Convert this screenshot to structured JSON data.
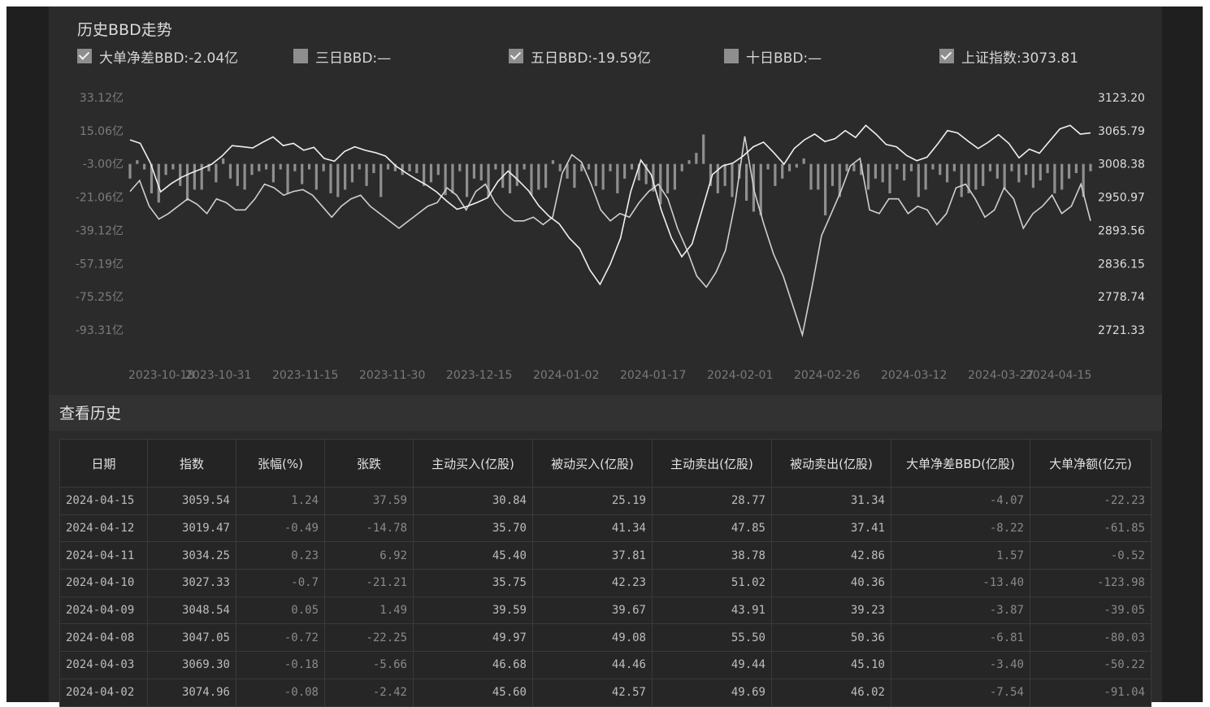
{
  "chart_header": {
    "title": "历史BBD走势",
    "legend": [
      {
        "label": "大单净差BBD:-2.04亿",
        "checked": true
      },
      {
        "label": "三日BBD:—",
        "checked": false
      },
      {
        "label": "五日BBD:-19.59亿",
        "checked": true
      },
      {
        "label": "十日BBD:—",
        "checked": false
      },
      {
        "label": "上证指数:3073.81",
        "checked": true
      }
    ]
  },
  "chart_data": {
    "type": "line",
    "left_axis_ticks": [
      "33.12亿",
      "15.06亿",
      "-3.00亿",
      "-21.06亿",
      "-39.12亿",
      "-57.19亿",
      "-75.25亿",
      "-93.31亿"
    ],
    "left_axis_values": [
      33.12,
      15.06,
      -3.0,
      -21.06,
      -39.12,
      -57.19,
      -75.25,
      -93.31
    ],
    "right_axis_ticks": [
      "3123.20",
      "3065.79",
      "3008.38",
      "2950.97",
      "2893.56",
      "2836.15",
      "2778.74",
      "2721.33"
    ],
    "right_axis_values": [
      3123.2,
      3065.79,
      3008.38,
      2950.97,
      2893.56,
      2836.15,
      2778.74,
      2721.33
    ],
    "x_ticks": [
      "2023-10-18",
      "2023-10-31",
      "2023-11-15",
      "2023-11-30",
      "2023-12-15",
      "2024-01-02",
      "2024-01-17",
      "2024-02-01",
      "2024-02-26",
      "2024-03-12",
      "2024-03-27",
      "2024-04-15"
    ],
    "grid": false,
    "series": [
      {
        "name": "大单净差BBD",
        "kind": "bar",
        "axis": "left",
        "values": [
          -8,
          2,
          -3,
          -16,
          -21,
          -6,
          -3,
          -12,
          -20,
          -14,
          -14,
          -4,
          -10,
          3,
          -8,
          -12,
          -14,
          -6,
          -4,
          -3,
          -10,
          -3,
          -16,
          -4,
          -11,
          -3,
          -14,
          -4,
          -16,
          -18,
          -14,
          -10,
          -3,
          -12,
          -5,
          -18,
          -3,
          -4,
          -6,
          -4,
          -5,
          -12,
          -10,
          -6,
          -17,
          -16,
          -4,
          -18,
          -8,
          -9,
          -18,
          -3,
          -13,
          -16,
          -12,
          -3,
          -17,
          -14,
          -13,
          2,
          -4,
          -8,
          -13,
          -4,
          -3,
          -12,
          -14,
          -4,
          -16,
          -8,
          -3,
          -9,
          -11,
          -15,
          -22,
          -16,
          -14,
          -4,
          2,
          6,
          16,
          -12,
          -16,
          -12,
          -18,
          -8,
          -20,
          -26,
          -28,
          -3,
          -12,
          -8,
          -4,
          -2,
          3,
          -14,
          -14,
          -28,
          -12,
          -18,
          -4,
          -4,
          -6,
          -14,
          -8,
          -10,
          -16,
          -3,
          -9,
          -4,
          -18,
          -14,
          -3,
          -6,
          -10,
          -4,
          -18,
          -16,
          -14,
          -12,
          -4,
          -8,
          -14,
          -4,
          -10,
          -6,
          -13,
          -9,
          -5,
          -16,
          -14,
          -8,
          -5,
          -18,
          -4
        ]
      },
      {
        "name": "五日BBD",
        "kind": "line",
        "axis": "left",
        "values": [
          -18,
          -12,
          -26,
          -33,
          -30,
          -26,
          -22,
          -25,
          -30,
          -22,
          -24,
          -28,
          -28,
          -22,
          -14,
          -16,
          -20,
          -18,
          -17,
          -20,
          -26,
          -32,
          -26,
          -22,
          -20,
          -26,
          -30,
          -34,
          -38,
          -34,
          -30,
          -26,
          -24,
          -16,
          -20,
          -28,
          -18,
          -14,
          -24,
          -30,
          -34,
          -34,
          -32,
          -36,
          -32,
          -8,
          2,
          -2,
          -14,
          -28,
          -34,
          -30,
          -32,
          -24,
          -18,
          -14,
          -22,
          -38,
          -50,
          -64,
          -70,
          -62,
          -50,
          -24,
          12,
          -18,
          -36,
          -52,
          -64,
          -80,
          -96,
          -70,
          -42,
          -30,
          -18,
          -4,
          0,
          -28,
          -30,
          -22,
          -22,
          -30,
          -26,
          -28,
          -36,
          -30,
          -16,
          -14,
          -22,
          -32,
          -28,
          -16,
          -22,
          -38,
          -30,
          -26,
          -20,
          -30,
          -26,
          -14,
          -34
        ]
      },
      {
        "name": "上证指数",
        "kind": "line",
        "axis": "right",
        "values": [
          3050,
          3044,
          3010,
          2960,
          2974,
          2985,
          2993,
          3000,
          3008,
          3022,
          3040,
          3038,
          3036,
          3046,
          3055,
          3040,
          3044,
          3032,
          3037,
          3018,
          3013,
          3030,
          3038,
          3032,
          3028,
          3022,
          3005,
          2993,
          2982,
          2972,
          2960,
          2944,
          2930,
          2935,
          2942,
          2950,
          2978,
          2996,
          2980,
          2962,
          2936,
          2918,
          2905,
          2880,
          2862,
          2825,
          2800,
          2835,
          2880,
          2960,
          3015,
          2990,
          2928,
          2880,
          2848,
          2870,
          2930,
          2990,
          3005,
          3010,
          3022,
          3038,
          3046,
          3028,
          3008,
          3035,
          3050,
          3060,
          3047,
          3052,
          3066,
          3054,
          3075,
          3060,
          3042,
          3038,
          3023,
          3014,
          3020,
          3042,
          3066,
          3062,
          3048,
          3035,
          3046,
          3059,
          3044,
          3019,
          3034,
          3027,
          3048,
          3069,
          3075,
          3060,
          3062
        ]
      }
    ]
  },
  "history": {
    "title": "查看历史",
    "columns": [
      "日期",
      "指数",
      "张幅(%)",
      "张跌",
      "主动买入(亿股)",
      "被动买入(亿股)",
      "主动卖出(亿股)",
      "被动卖出(亿股)",
      "大单净差BBD(亿股)",
      "大单净额(亿元)"
    ],
    "rows": [
      [
        "2024-04-15",
        "3059.54",
        "1.24",
        "37.59",
        "30.84",
        "25.19",
        "28.77",
        "31.34",
        "-4.07",
        "-22.23"
      ],
      [
        "2024-04-12",
        "3019.47",
        "-0.49",
        "-14.78",
        "35.70",
        "41.34",
        "47.85",
        "37.41",
        "-8.22",
        "-61.85"
      ],
      [
        "2024-04-11",
        "3034.25",
        "0.23",
        "6.92",
        "45.40",
        "37.81",
        "38.78",
        "42.86",
        "1.57",
        "-0.52"
      ],
      [
        "2024-04-10",
        "3027.33",
        "-0.7",
        "-21.21",
        "35.75",
        "42.23",
        "51.02",
        "40.36",
        "-13.40",
        "-123.98"
      ],
      [
        "2024-04-09",
        "3048.54",
        "0.05",
        "1.49",
        "39.59",
        "39.67",
        "43.91",
        "39.23",
        "-3.87",
        "-39.05"
      ],
      [
        "2024-04-08",
        "3047.05",
        "-0.72",
        "-22.25",
        "49.97",
        "49.08",
        "55.50",
        "50.36",
        "-6.81",
        "-80.03"
      ],
      [
        "2024-04-03",
        "3069.30",
        "-0.18",
        "-5.66",
        "46.68",
        "44.46",
        "49.44",
        "45.10",
        "-3.40",
        "-50.22"
      ],
      [
        "2024-04-02",
        "3074.96",
        "-0.08",
        "-2.42",
        "45.60",
        "42.57",
        "49.69",
        "46.02",
        "-7.54",
        "-91.04"
      ]
    ]
  }
}
